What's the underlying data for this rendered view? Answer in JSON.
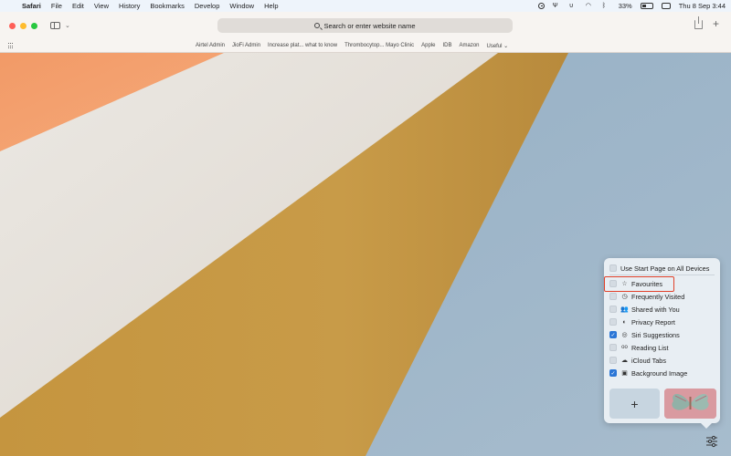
{
  "menubar": {
    "app_name": "Safari",
    "menus": [
      "File",
      "Edit",
      "View",
      "History",
      "Bookmarks",
      "Develop",
      "Window",
      "Help"
    ],
    "battery_percent": "33%",
    "datetime": "Thu 8 Sep  3:44"
  },
  "toolbar": {
    "address_placeholder": "Search or enter website name"
  },
  "favorites_bar": {
    "links": [
      "Airtel Admin",
      "JioFi Admin",
      "Increase plat... what to know",
      "Thrombocytop... Mayo Clinic",
      "Apple",
      "IDB",
      "Amazon"
    ],
    "folder": "Useful"
  },
  "customize_panel": {
    "sync_option": {
      "label": "Use Start Page on All Devices",
      "checked": false
    },
    "sections": [
      {
        "label": "Favourites",
        "icon": "star-icon",
        "checked": false
      },
      {
        "label": "Frequently Visited",
        "icon": "clock-icon",
        "checked": false
      },
      {
        "label": "Shared with You",
        "icon": "people-icon",
        "checked": false
      },
      {
        "label": "Privacy Report",
        "icon": "shield-icon",
        "checked": false
      },
      {
        "label": "Siri Suggestions",
        "icon": "siri-icon",
        "checked": true
      },
      {
        "label": "Reading List",
        "icon": "glasses-icon",
        "checked": false
      },
      {
        "label": "iCloud Tabs",
        "icon": "cloud-icon",
        "checked": false
      },
      {
        "label": "Background Image",
        "icon": "image-icon",
        "checked": true
      }
    ],
    "add_background_label": "+"
  },
  "colors": {
    "accent": "#2b76d6",
    "highlight": "#e0412a",
    "wallpaper_orange": "#f3a36f",
    "wallpaper_cream": "#e6e2dc",
    "wallpaper_gold": "#c99a43",
    "wallpaper_blue": "#9fb6c9"
  }
}
